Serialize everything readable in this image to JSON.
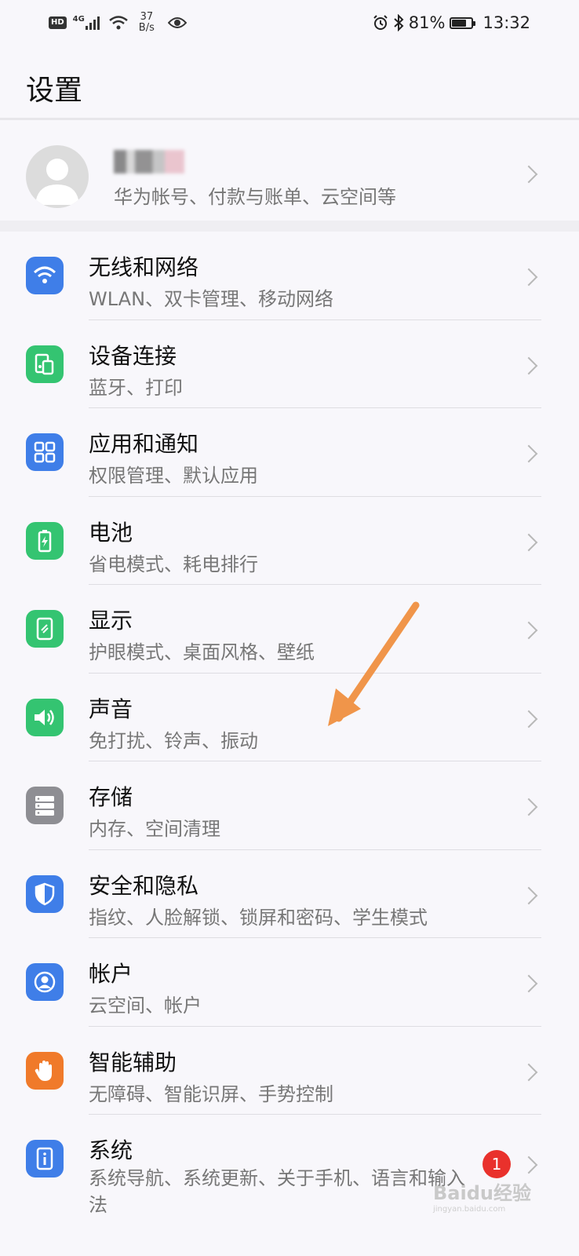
{
  "status_bar": {
    "hd": "HD",
    "network": "4G",
    "speed_value": "37",
    "speed_unit": "B/s",
    "battery_percent": "81%",
    "battery_level": 0.81,
    "time": "13:32"
  },
  "header": {
    "title": "设置"
  },
  "account": {
    "subtitle": "华为帐号、付款与账单、云空间等"
  },
  "settings": [
    {
      "title": "无线和网络",
      "subtitle": "WLAN、双卡管理、移动网络",
      "icon": "wifi-icon",
      "color": "#3f7ee8"
    },
    {
      "title": "设备连接",
      "subtitle": "蓝牙、打印",
      "icon": "device-connection-icon",
      "color": "#34c471"
    },
    {
      "title": "应用和通知",
      "subtitle": "权限管理、默认应用",
      "icon": "apps-grid-icon",
      "color": "#3f7ee8"
    },
    {
      "title": "电池",
      "subtitle": "省电模式、耗电排行",
      "icon": "battery-icon",
      "color": "#34c471"
    },
    {
      "title": "显示",
      "subtitle": "护眼模式、桌面风格、壁纸",
      "icon": "display-icon",
      "color": "#34c471"
    },
    {
      "title": "声音",
      "subtitle": "免打扰、铃声、振动",
      "icon": "speaker-icon",
      "color": "#34c471"
    },
    {
      "title": "存储",
      "subtitle": "内存、空间清理",
      "icon": "storage-icon",
      "color": "#8e8e93"
    },
    {
      "title": "安全和隐私",
      "subtitle": "指纹、人脸解锁、锁屏和密码、学生模式",
      "icon": "shield-icon",
      "color": "#3f7ee8"
    },
    {
      "title": "帐户",
      "subtitle": "云空间、帐户",
      "icon": "account-icon",
      "color": "#3f7ee8"
    },
    {
      "title": "智能辅助",
      "subtitle": "无障碍、智能识屏、手势控制",
      "icon": "hand-icon",
      "color": "#f07a2a"
    },
    {
      "title": "系统",
      "subtitle": "系统导航、系统更新、关于手机、语言和输入法",
      "icon": "phone-info-icon",
      "color": "#3f7ee8",
      "badge": "1"
    }
  ],
  "annotation_arrow_color": "#f0954a",
  "watermark": {
    "text": "Baidu经验",
    "sub": "jingyan.baidu.com"
  }
}
